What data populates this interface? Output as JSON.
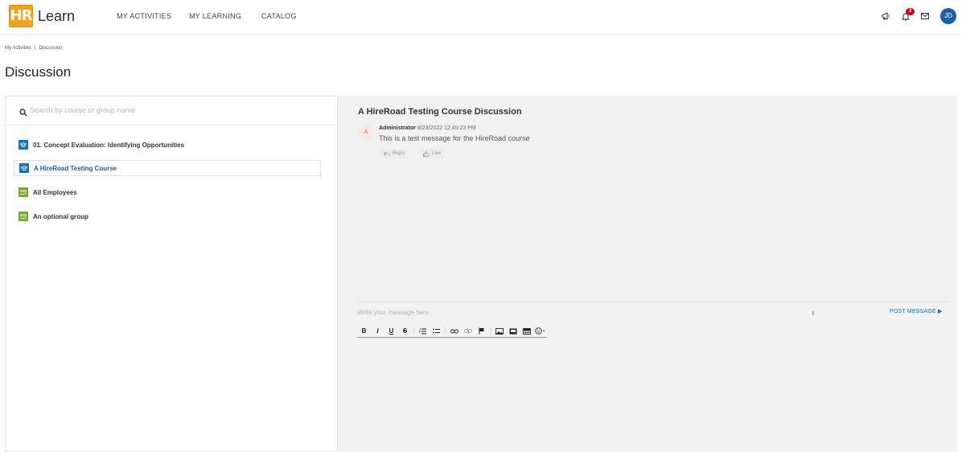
{
  "app": {
    "logo_text": "HR",
    "brand": "Learn"
  },
  "nav": {
    "items": [
      {
        "label": "MY ACTIVITIES"
      },
      {
        "label": "MY LEARNING"
      },
      {
        "label": "CATALOG"
      }
    ]
  },
  "header_icons": {
    "notification_count": "3",
    "avatar_initials": "JD",
    "icons": [
      "megaphone-icon",
      "bell-icon",
      "mail-icon"
    ]
  },
  "breadcrumb": {
    "items": [
      "My Activities",
      "Discussion"
    ],
    "separator": "|"
  },
  "page": {
    "title": "Discussion"
  },
  "search": {
    "placeholder": "Search by course or group name"
  },
  "discussions": [
    {
      "label": "01. Concept Evaluation: Identifying Opportunities",
      "type": "course",
      "active": false
    },
    {
      "label": "A HireRoad Testing Course",
      "type": "course",
      "active": true
    },
    {
      "label": "All Employees",
      "type": "group",
      "active": false
    },
    {
      "label": "An optional group",
      "type": "group",
      "active": false
    }
  ],
  "thread": {
    "title": "A HireRoad Testing Course Discussion",
    "messages": [
      {
        "avatar": "A",
        "author": "Administrator",
        "date": "8/23/2022 12:45:23 PM",
        "text": "This is a test message for the HireRoad course",
        "reply_label": "Reply",
        "like_label": "Like"
      }
    ]
  },
  "composer": {
    "placeholder": "Write your message here",
    "post_label": "POST MESSAGE ▶",
    "toolbar": [
      "B",
      "I",
      "U",
      "S"
    ]
  },
  "colors": {
    "accent": "#1c6ca5",
    "logo": "#f4a21d",
    "badge": "#d0021b",
    "course_icon": "#1a73b8",
    "group_icon": "#7aa92b"
  }
}
